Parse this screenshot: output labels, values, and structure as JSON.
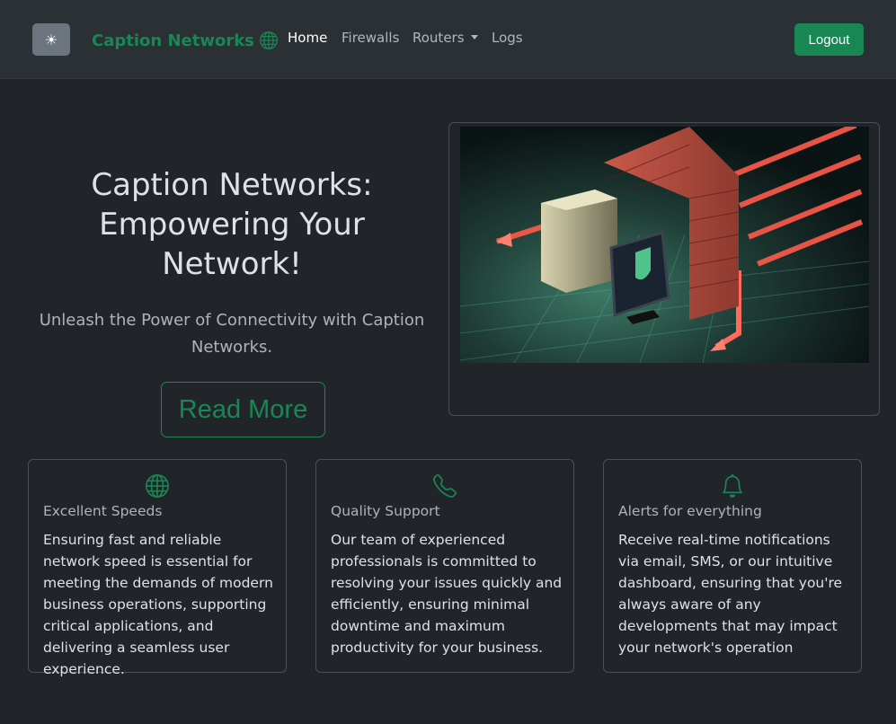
{
  "navbar": {
    "theme_toggle_icon": "☀",
    "brand": "Caption Networks",
    "links": [
      {
        "label": "Home"
      },
      {
        "label": "Firewalls"
      },
      {
        "label": "Routers"
      },
      {
        "label": "Logs"
      }
    ],
    "logout_label": "Logout"
  },
  "hero": {
    "title": "Caption Networks: Empowering Your Network!",
    "subtitle": "Unleash the Power of Connectivity with Caption Networks.",
    "read_more_label": "Read More",
    "image_icon": "firewall-illustration"
  },
  "features": [
    {
      "icon": "globe-icon",
      "title": "Excellent Speeds",
      "text": "Ensuring fast and reliable network speed is essential for meeting the demands of modern business operations, supporting critical applications, and delivering a seamless user experience."
    },
    {
      "icon": "phone-icon",
      "title": "Quality Support",
      "text": "Our team of experienced professionals is committed to resolving your issues quickly and efficiently, ensuring minimal downtime and maximum productivity for your business."
    },
    {
      "icon": "bell-icon",
      "title": "Alerts for everything",
      "text": "Receive real-time notifications via email, SMS, or our intuitive dashboard, ensuring that you're always aware of any developments that may impact your network's operation"
    }
  ],
  "colors": {
    "accent": "#198754",
    "background": "#212529",
    "navbar": "#2b3035"
  }
}
